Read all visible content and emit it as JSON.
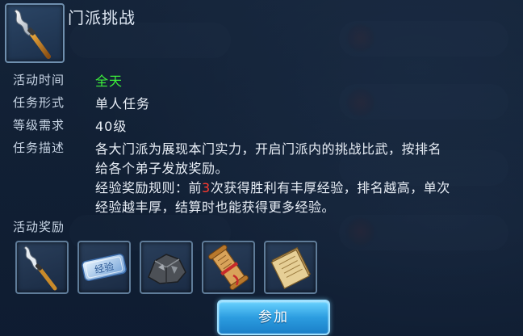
{
  "header": {
    "title": "门派挑战",
    "icon": "spear-icon"
  },
  "fields": {
    "activity_time_label": "活动时间",
    "activity_time_value": "全天",
    "activity_time_color": "#3df03a",
    "task_form_label": "任务形式",
    "task_form_value": "单人任务",
    "level_req_label": "等级需求",
    "level_req_value": "40级",
    "task_desc_label": "任务描述",
    "task_desc_line1": "各大门派为展现本门实力，开启门派内的挑战比武，按排名",
    "task_desc_line2": "给各个弟子发放奖励。",
    "rule_prefix": "经验奖励规则：前",
    "rule_number": "3",
    "rule_number_color": "#ff3b2f",
    "rule_suffix": "次获得胜利有丰厚经验，排名越高，单次",
    "rule_line2": "经验越丰厚，结算时也能获得更多经验。"
  },
  "rewards": {
    "label": "活动奖励",
    "items": [
      {
        "icon": "spear-icon"
      },
      {
        "icon": "experience-token-icon",
        "text": "经验"
      },
      {
        "icon": "ore-icon"
      },
      {
        "icon": "scroll-icon"
      },
      {
        "icon": "paper-stack-icon"
      }
    ]
  },
  "actions": {
    "join_label": "参加"
  }
}
